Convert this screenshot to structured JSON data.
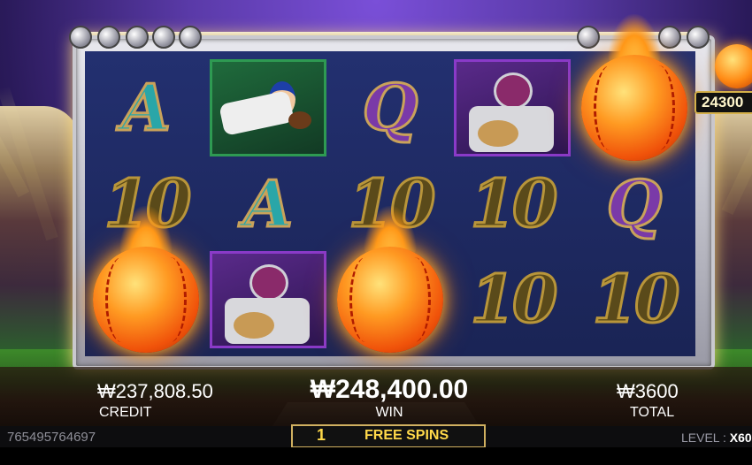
{
  "reels": {
    "columns": [
      [
        "A",
        "10",
        "fireball"
      ],
      [
        "player-slider",
        "A",
        "player-catcher"
      ],
      [
        "Q",
        "10",
        "fireball"
      ],
      [
        "player-catcher",
        "10",
        "10"
      ],
      [
        "fireball",
        "Q",
        "10"
      ]
    ],
    "symbol_text": {
      "A": "A",
      "Q": "Q",
      "ten": "10"
    }
  },
  "side_pot": {
    "value": "24300"
  },
  "panel": {
    "credit_value": "₩237,808.50",
    "credit_label": "CREDIT",
    "win_value": "₩248,400.00",
    "win_label": "WIN",
    "total_value": "₩3600",
    "total_label": "TOTAL"
  },
  "status": {
    "round_id": "765495764697",
    "free_spins_count": "1",
    "free_spins_label": "FREE SPINS",
    "level_label": "LEVEL :",
    "level_value": "X60"
  },
  "colors": {
    "frame": "#c9c9cf",
    "fireball": "#f0520a",
    "free_spins_text": "#ffd94a",
    "letter_A": "#2aa6a8",
    "letter_Q": "#7a3aa8"
  },
  "icons": [
    "fireball-icon",
    "baseball-player-icon",
    "bolt-icon"
  ]
}
